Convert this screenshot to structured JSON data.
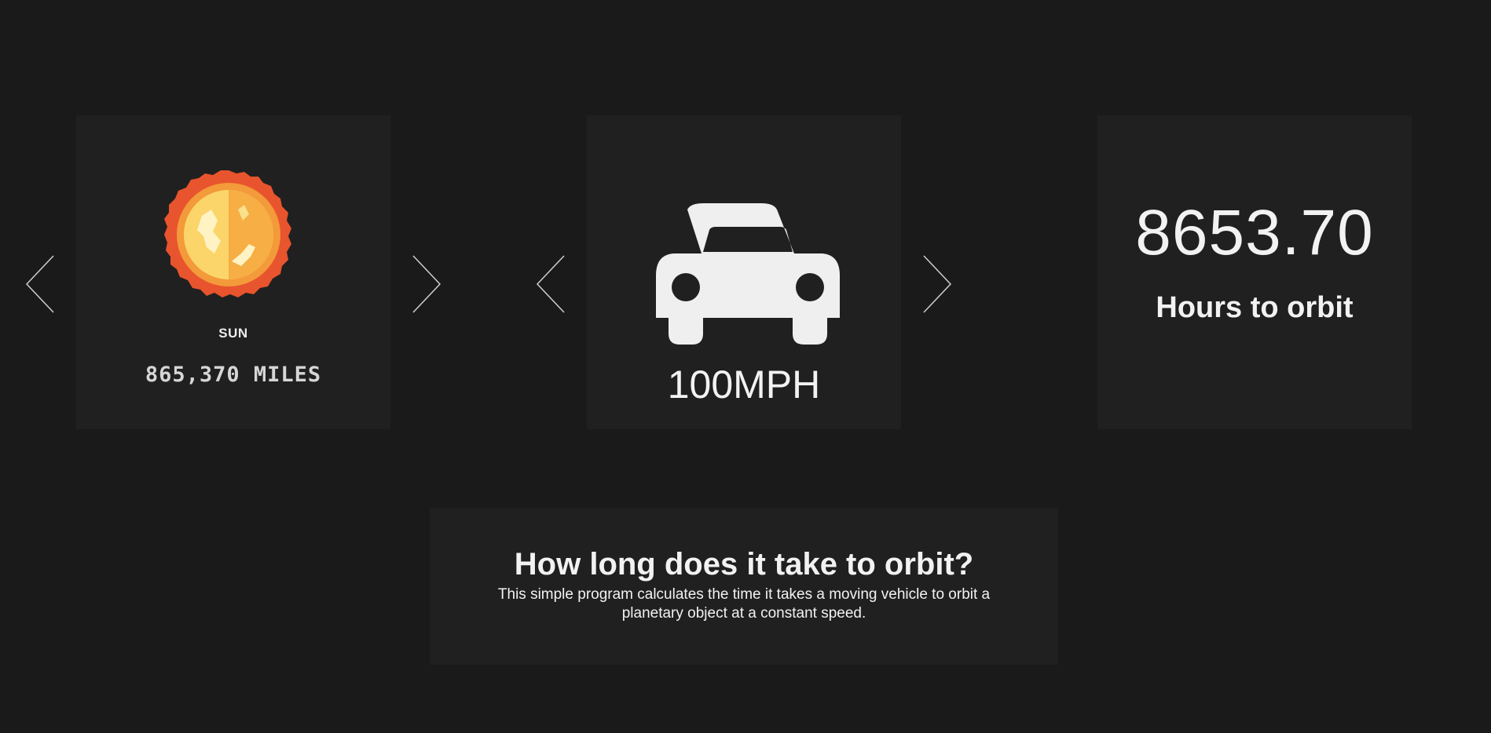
{
  "planet": {
    "name": "SUN",
    "distance": "865,370 MILES"
  },
  "vehicle": {
    "speed": "100MPH",
    "icon": "car-icon"
  },
  "result": {
    "value": "8653.70",
    "label": "Hours to orbit"
  },
  "info": {
    "title": "How long does it take to orbit?",
    "description": "This simple program calculates the time it takes a moving vehicle to orbit a planetary object at a constant speed."
  },
  "colors": {
    "background": "#1a1a1a",
    "panel": "#202020",
    "text": "#f2f2f2",
    "sun_outer": "#e8542d",
    "sun_mid": "#f6a23a",
    "sun_inner": "#fbd56a"
  }
}
